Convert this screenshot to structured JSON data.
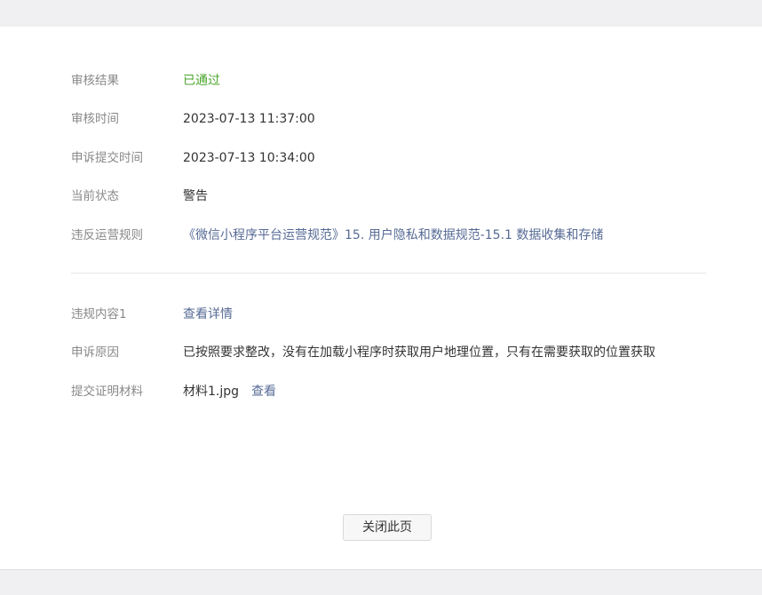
{
  "details": {
    "review_result": {
      "label": "审核结果",
      "value": "已通过",
      "value_color": "#4ba62c"
    },
    "review_time": {
      "label": "审核时间",
      "value": "2023-07-13 11:37:00"
    },
    "appeal_submit_time": {
      "label": "申诉提交时间",
      "value": "2023-07-13 10:34:00"
    },
    "current_status": {
      "label": "当前状态",
      "value": "警告"
    },
    "violated_rule": {
      "label": "违反运营规则",
      "value": "《微信小程序平台运营规范》15. 用户隐私和数据规范-15.1 数据收集和存储"
    }
  },
  "appeal": {
    "violation_content": {
      "label": "违规内容1",
      "link_text": "查看详情"
    },
    "appeal_reason": {
      "label": "申诉原因",
      "value": "已按照要求整改，没有在加载小程序时获取用户地理位置，只有在需要获取的位置获取"
    },
    "evidence": {
      "label": "提交证明材料",
      "file_name": "材料1.jpg",
      "view_text": "查看"
    }
  },
  "actions": {
    "close_label": "关闭此页"
  },
  "colors": {
    "link": "#576b95",
    "success": "#4ba62c",
    "label": "#888888",
    "text": "#333333"
  }
}
